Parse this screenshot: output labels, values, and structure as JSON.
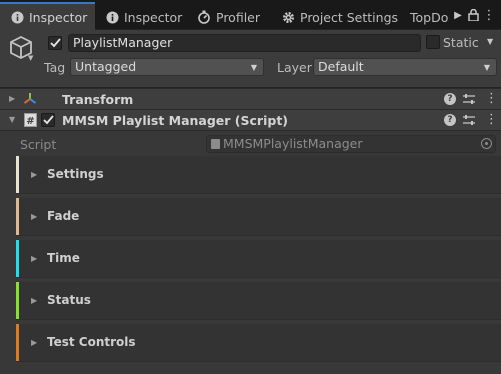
{
  "tabs": [
    {
      "label": "Inspector",
      "icon": "info-icon",
      "active": true
    },
    {
      "label": "Inspector",
      "icon": "info-icon",
      "active": false
    },
    {
      "label": "Profiler",
      "icon": "profiler-icon",
      "active": false
    },
    {
      "label": "Project Settings",
      "icon": "gear-icon",
      "active": false
    },
    {
      "label": "TopDo",
      "icon": "",
      "active": false
    }
  ],
  "header": {
    "object_name": "PlaylistManager",
    "active_checked": true,
    "static_label": "Static",
    "tag_label": "Tag",
    "tag_value": "Untagged",
    "layer_label": "Layer",
    "layer_value": "Default"
  },
  "components": [
    {
      "title": "Transform",
      "icon": "transform-icon",
      "expanded": false
    },
    {
      "title": "MMSM Playlist Manager (Script)",
      "icon": "script-icon",
      "expanded": true,
      "enabled": true
    }
  ],
  "script_field": {
    "label": "Script",
    "value": "MMSMPlaylistManager"
  },
  "sections": [
    {
      "title": "Settings",
      "color": "#e8e4d0"
    },
    {
      "title": "Fade",
      "color": "#e0b98e"
    },
    {
      "title": "Time",
      "color": "#1ee0e8"
    },
    {
      "title": "Status",
      "color": "#86e22a"
    },
    {
      "title": "Test Controls",
      "color": "#e07a1e"
    }
  ],
  "colors": {
    "active_tab_accent": "#3a79bb",
    "panel_bg": "#383838",
    "tabbar_bg": "#191919"
  }
}
